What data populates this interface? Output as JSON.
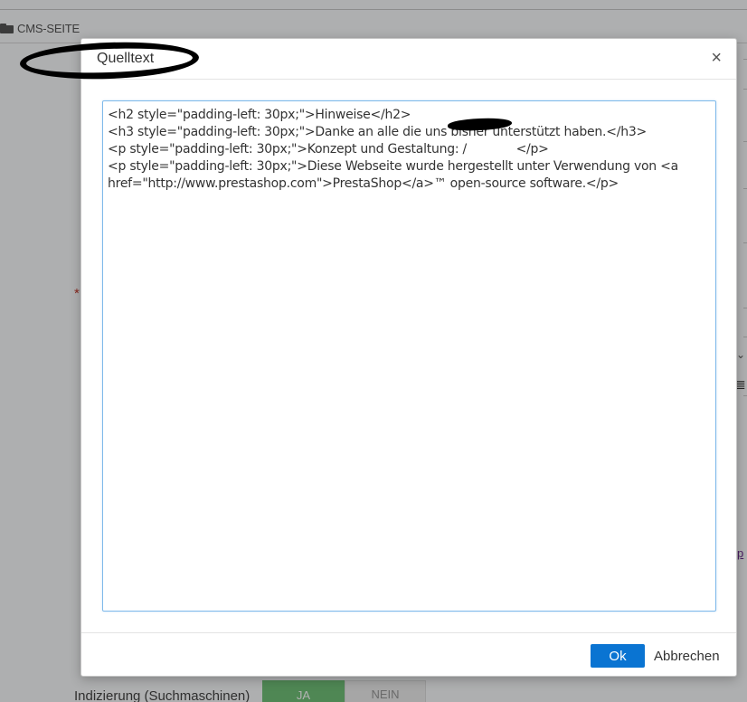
{
  "background": {
    "header_label": "CMS-SEITE",
    "required_marker": "*",
    "right_glyph_1": "⌄",
    "right_glyph_2": "≣",
    "right_link_fragment": "p",
    "index_label": "Indizierung (Suchmaschinen)",
    "toggle_yes": "JA",
    "toggle_no": "NEIN"
  },
  "dialog": {
    "title": "Quelltext",
    "close_label": "×",
    "source_text": "<h2 style=\"padding-left: 30px;\">Hinweise</h2>\n<h3 style=\"padding-left: 30px;\">Danke an alle die uns bisher unterstützt haben.</h3>\n<p style=\"padding-left: 30px;\">Konzept und Gestaltung: /             </p>\n<p style=\"padding-left: 30px;\">Diese Webseite wurde hergestellt unter Verwendung von <a href=\"http://www.prestashop.com\">PrestaShop</a>™ open-source software.</p>",
    "ok_label": "Ok",
    "cancel_label": "Abbrechen"
  },
  "colors": {
    "primary_button": "#0a74d2",
    "textarea_focus_border": "#7fb9ea",
    "toggle_active": "#72c279",
    "required": "#c0392b"
  }
}
